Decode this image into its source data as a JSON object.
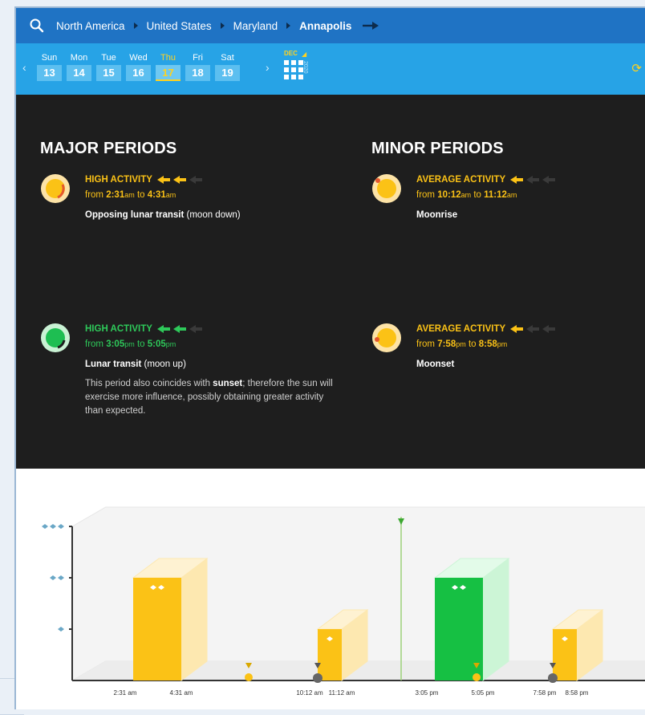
{
  "breadcrumb": {
    "items": [
      "North America",
      "United States",
      "Maryland",
      "Annapolis"
    ]
  },
  "days": [
    {
      "name": "Sun",
      "num": "13"
    },
    {
      "name": "Mon",
      "num": "14"
    },
    {
      "name": "Tue",
      "num": "15"
    },
    {
      "name": "Wed",
      "num": "16"
    },
    {
      "name": "Thu",
      "num": "17"
    },
    {
      "name": "Fri",
      "num": "18"
    },
    {
      "name": "Sat",
      "num": "19"
    }
  ],
  "selected_day": "Thu",
  "calendar": {
    "month": "DEC",
    "year": "2020"
  },
  "major": {
    "title": "MAJOR PERIODS",
    "periods": [
      {
        "level": "HIGH ACTIVITY",
        "from_word": "from",
        "to_word": "to",
        "start": "2:31",
        "start_ap": "am",
        "end": "4:31",
        "end_ap": "am",
        "event_bold": "Opposing lunar transit",
        "event_rest": " (moon down)",
        "note": ""
      },
      {
        "level": "HIGH ACTIVITY",
        "from_word": "from",
        "to_word": "to",
        "start": "3:05",
        "start_ap": "pm",
        "end": "5:05",
        "end_ap": "pm",
        "event_bold": "Lunar transit",
        "event_rest": " (moon up)",
        "note_a": "This period also coincides with ",
        "note_b": "sunset",
        "note_c": "; therefore the sun will exercise more influence, possibly obtaining greater activity than expected."
      }
    ]
  },
  "minor": {
    "title": "MINOR PERIODS",
    "periods": [
      {
        "level": "AVERAGE ACTIVITY",
        "from_word": "from",
        "to_word": "to",
        "start": "10:12",
        "start_ap": "am",
        "end": "11:12",
        "end_ap": "am",
        "event_bold": "Moonrise"
      },
      {
        "level": "AVERAGE ACTIVITY",
        "from_word": "from",
        "to_word": "to",
        "start": "7:58",
        "start_ap": "pm",
        "end": "8:58",
        "end_ap": "pm",
        "event_bold": "Moonset"
      }
    ]
  },
  "colors": {
    "topbar": "#1f73c4",
    "daybar": "#27a3e6",
    "accent_yellow": "#fbc216",
    "accent_green": "#2ec95a",
    "dark_bg": "#1e1e1e"
  },
  "chart_data": {
    "type": "bar",
    "levels": [
      "",
      "+",
      "++",
      "+++"
    ],
    "bars": [
      {
        "start": "2:31 am",
        "end": "4:31 am",
        "level": 2,
        "color": "yellow"
      },
      {
        "start": "10:12 am",
        "end": "11:12 am",
        "level": 1,
        "color": "yellow"
      },
      {
        "start": "3:05 pm",
        "end": "5:05 pm",
        "level": 2,
        "color": "green"
      },
      {
        "start": "7:58 pm",
        "end": "8:58 pm",
        "level": 1,
        "color": "yellow"
      }
    ],
    "tick_labels": [
      "2:31 am",
      "4:31 am",
      "10:12 am",
      "11:12 am",
      "3:05 pm",
      "5:05 pm",
      "7:58 pm",
      "8:58 pm"
    ],
    "markers": [
      "sunrise",
      "moonrise",
      "moon-transit",
      "sunset",
      "moonset"
    ]
  }
}
